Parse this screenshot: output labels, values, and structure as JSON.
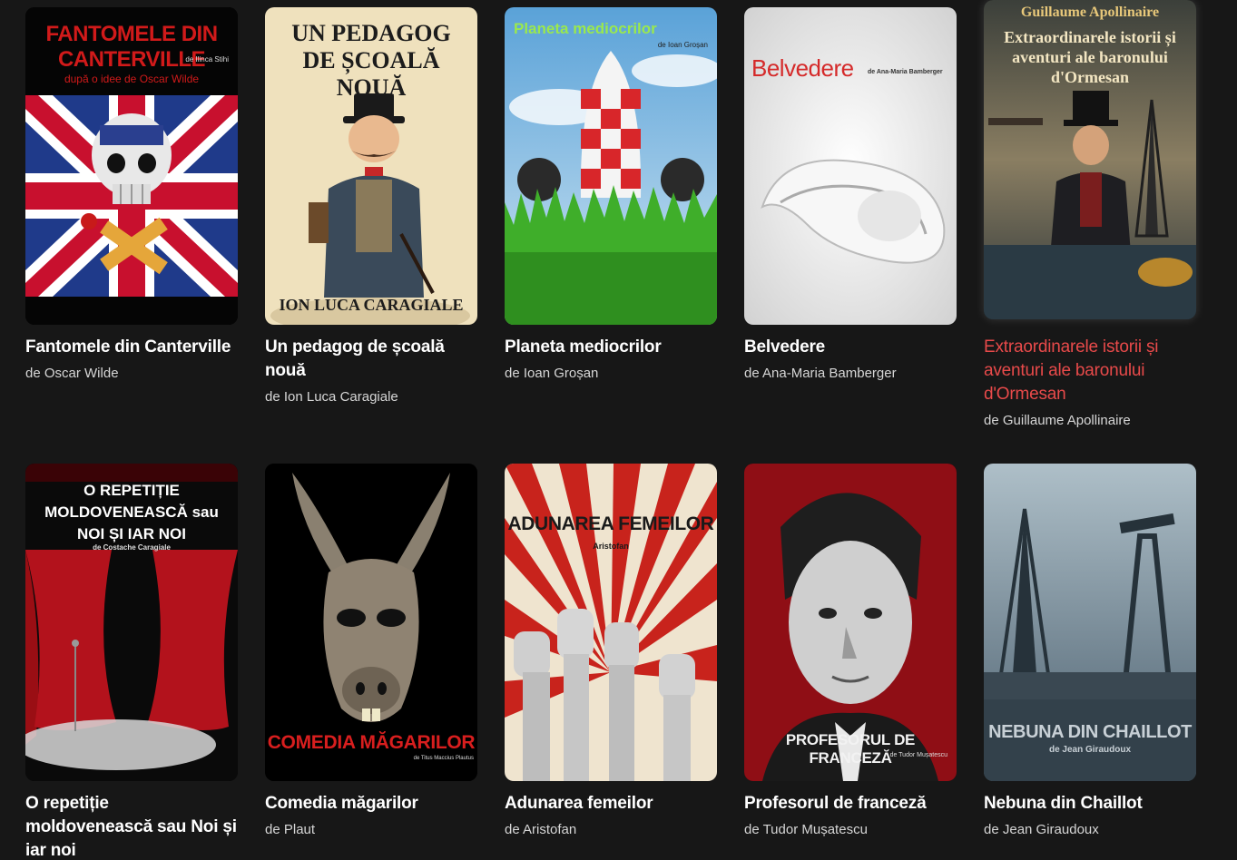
{
  "plays": [
    {
      "title": "Fantomele din Canterville",
      "author": "de Oscar Wilde",
      "poster": {
        "image": "union-jack-skull-icon",
        "title_text": "FANTOMELE DIN CANTERVILLE",
        "credit": "de Ilinca Stihi",
        "sub": "după o idee de Oscar Wilde",
        "accent": "#c0152a"
      }
    },
    {
      "title": "Un pedagog de școală nouă",
      "author": "de Ion Luca Caragiale",
      "poster": {
        "image": "mustached-teacher-caricature-icon",
        "title_text": "UN PEDAGOG DE ȘCOALĂ NOUĂ",
        "footer": "ION LUCA CARAGIALE",
        "accent": "#efe1bd"
      }
    },
    {
      "title": "Planeta mediocrilor",
      "author": "de Ioan Groșan",
      "poster": {
        "image": "checkered-rocket-icon",
        "title_text": "Planeta mediocrilor",
        "credit": "de Ioan Groșan",
        "accent": "#7bd63a"
      }
    },
    {
      "title": "Belvedere",
      "author": "de Ana-Maria Bamberger",
      "poster": {
        "image": "mobius-ribbon-icon",
        "title_text": "Belvedere",
        "credit": "de Ana-Maria Bamberger",
        "accent": "#e03a3a"
      }
    },
    {
      "title": "Extraordinarele istorii și aventuri ale baronului d'Ormesan",
      "author": "de Guillaume Apollinaire",
      "active": true,
      "poster": {
        "image": "top-hat-gentleman-eiffel-icon",
        "header": "Guillaume Apollinaire",
        "title_text": "Extraordinarele istorii și aventuri ale baronului d'Ormesan",
        "accent": "#e8c87a"
      }
    },
    {
      "title": "O repetiție moldovenească sau Noi și iar noi",
      "author": "",
      "poster": {
        "image": "theater-curtain-stage-icon",
        "title_text": "O REPETIȚIE MOLDOVENEASCĂ sau NOI ȘI IAR NOI",
        "credit": "de Costache Caragiale",
        "accent": "#b3121c"
      }
    },
    {
      "title": "Comedia măgarilor",
      "author": "de Plaut",
      "poster": {
        "image": "donkey-mask-icon",
        "title_text": "COMEDIA MĂGARILOR",
        "credit": "de Titus Maccius Plautus",
        "accent": "#d81e1e"
      }
    },
    {
      "title": "Adunarea femeilor",
      "author": "de Aristofan",
      "poster": {
        "image": "raised-fists-icon",
        "title_text": "ADUNAREA FEMEILOR",
        "credit": "Aristofan",
        "accent": "#c8231c"
      }
    },
    {
      "title": "Profesorul de franceză",
      "author": "de Tudor Mușatescu",
      "poster": {
        "image": "man-portrait-icon",
        "title_text": "PROFESORUL DE FRANCEZĂ",
        "credit": "de Tudor Mușatescu",
        "accent": "#b0121c"
      }
    },
    {
      "title": "Nebuna din Chaillot",
      "author": "de Jean Giraudoux",
      "poster": {
        "image": "eiffel-oil-pump-icon",
        "title_text": "NEBUNA DIN CHAILLOT",
        "credit": "de Jean Giraudoux",
        "accent": "#4d6170"
      }
    }
  ]
}
